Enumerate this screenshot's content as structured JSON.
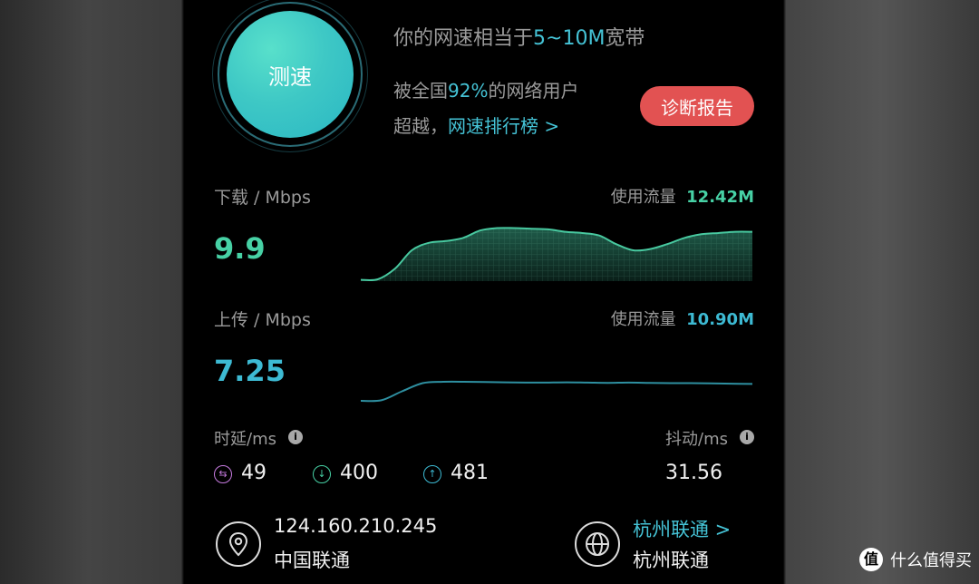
{
  "speed_test": {
    "button_label": "测速"
  },
  "summary": {
    "bandwidth_prefix": "你的网速相当于",
    "bandwidth_value": "5~10M",
    "bandwidth_suffix": "宽带",
    "rank_prefix": "被全国",
    "rank_percent": "92%",
    "rank_suffix": "的网络用户",
    "beat_text": "超越，",
    "ranking_link": "网速排行榜 >",
    "report_button": "诊断报告"
  },
  "download": {
    "label": "下载 / Mbps",
    "traffic_label": "使用流量",
    "traffic_value": "12.42M",
    "speed": "9.9",
    "curve": [
      0.02,
      0.03,
      0.2,
      0.5,
      0.62,
      0.65,
      0.7,
      0.82,
      0.86,
      0.86,
      0.85,
      0.84,
      0.8,
      0.78,
      0.74,
      0.6,
      0.5,
      0.52,
      0.6,
      0.7,
      0.76,
      0.78,
      0.8,
      0.8
    ]
  },
  "upload": {
    "label": "上传 / Mbps",
    "traffic_label": "使用流量",
    "traffic_value": "10.90M",
    "speed": "7.25",
    "curve": [
      0.0,
      0.02,
      0.35,
      0.65,
      0.7,
      0.7,
      0.69,
      0.68,
      0.67,
      0.67,
      0.68,
      0.67,
      0.66,
      0.67,
      0.66,
      0.65,
      0.65,
      0.64,
      0.63,
      0.62
    ]
  },
  "latency": {
    "label": "时延/ms",
    "info_glyph": "i",
    "items": [
      {
        "icon_glyph": "⇆",
        "value": "49",
        "color": "#c77be0"
      },
      {
        "icon_glyph": "↓",
        "value": "400",
        "color": "#47d1a5"
      },
      {
        "icon_glyph": "↑",
        "value": "481",
        "color": "#3dbad3"
      }
    ]
  },
  "jitter": {
    "label": "抖动/ms",
    "info_glyph": "i",
    "value": "31.56"
  },
  "network": {
    "ip": "124.160.210.245",
    "isp": "中国联通",
    "city_link": "杭州联通 >",
    "city": "杭州联通"
  },
  "watermark": {
    "badge_glyph": "值",
    "text": "什么值得买"
  },
  "colors": {
    "accent": "#45c3d6",
    "green": "#47d1a5",
    "report": "#e25252"
  }
}
